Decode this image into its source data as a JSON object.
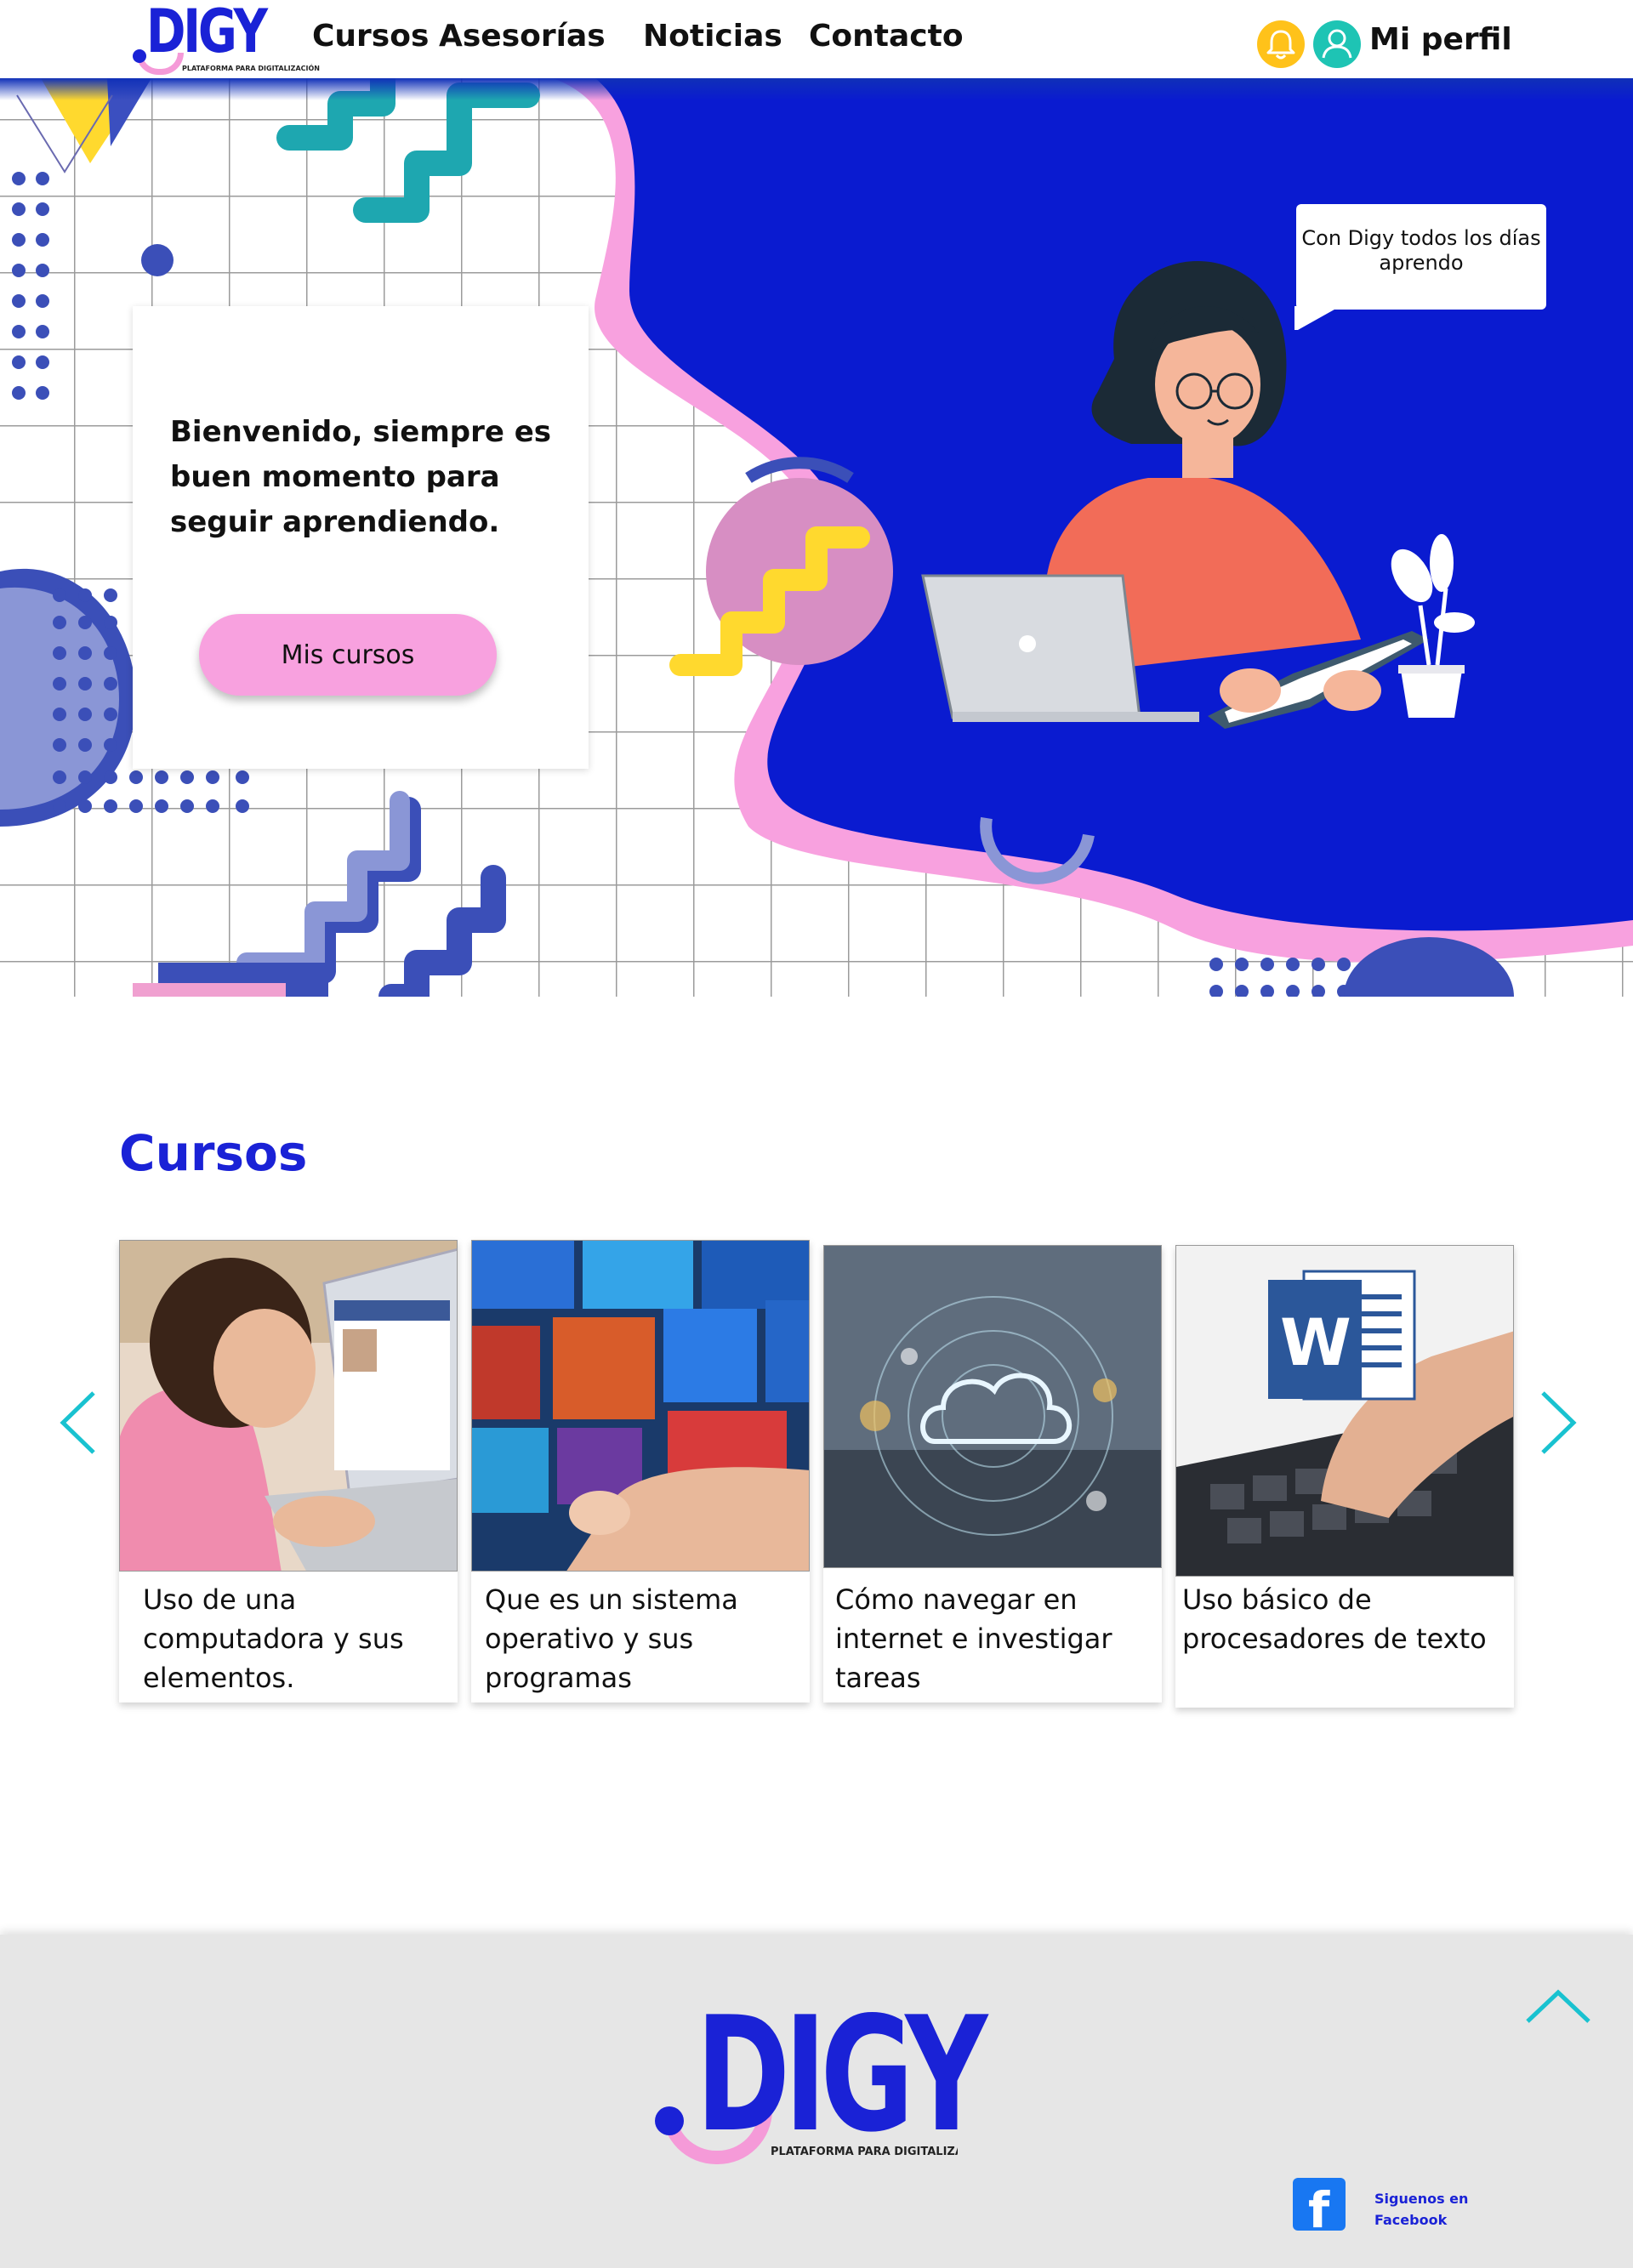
{
  "header": {
    "logo_text": "DIGY",
    "logo_tagline": "PLATAFORMA PARA DIGITALIZACIÓN",
    "nav": [
      "Cursos",
      "Asesorías",
      "Noticias",
      "Contacto"
    ],
    "profile_label": "Mi perfil",
    "icons": [
      "bell-icon",
      "user-icon"
    ]
  },
  "hero": {
    "welcome_text": "Bienvenido, siempre es buen momento para seguir aprendiendo.",
    "cta_label": "Mis cursos",
    "speech_bubble": "Con Digy todos los días aprendo"
  },
  "courses": {
    "title": "Cursos",
    "items": [
      {
        "title": "Uso de una computadora y sus elementos.",
        "image": "girl-using-laptop"
      },
      {
        "title": "Que es un sistema operativo y sus programas",
        "image": "finger-touching-windows-tiles"
      },
      {
        "title": "Cómo navegar en internet e investigar tareas",
        "image": "cloud-network-laptop"
      },
      {
        "title": " Uso básico de procesadores de texto",
        "image": "word-logo-over-keyboard"
      }
    ]
  },
  "footer": {
    "logo_text": "DIGY",
    "logo_tagline": "PLATAFORMA PARA DIGITALIZACIÓN",
    "social_label": "Siguenos en Facebook",
    "social_icon": "facebook-icon"
  },
  "colors": {
    "brand_blue": "#1a22d6",
    "hero_blue": "#0a1bd0",
    "brand_pink": "#f8a1df",
    "accent_teal": "#1ec4b4",
    "accent_yellow": "#ffc21a",
    "footer_bg": "#e6e6e6"
  }
}
